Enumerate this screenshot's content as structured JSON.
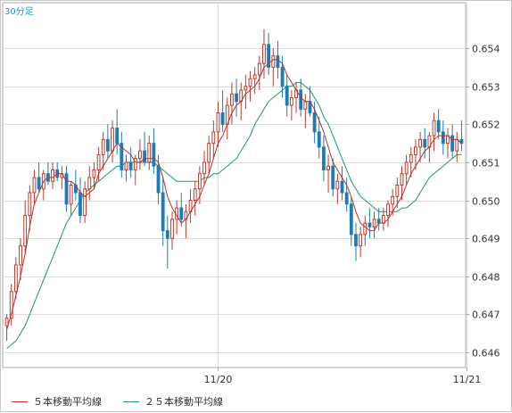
{
  "period_label": "30分足",
  "legend": {
    "ma5": "５本移動平均線",
    "ma25": "２５本移動平均線"
  },
  "colors": {
    "up": "#c0392b",
    "down": "#1f7bb8",
    "ma5": "#b6332b",
    "ma25": "#1a9a6a",
    "grid": "#dddddd",
    "axis": "#aaaaaa"
  },
  "chart_data": {
    "type": "candlestick",
    "title": "",
    "y_ticks": [
      "0.646",
      "0.647",
      "0.648",
      "0.649",
      "0.650",
      "0.651",
      "0.652",
      "0.653",
      "0.654"
    ],
    "x_labels": [
      {
        "label": "11/20",
        "index": 46
      },
      {
        "label": "11/21",
        "index": 100
      }
    ],
    "ylim": [
      0.6456,
      0.6552
    ],
    "grid": true,
    "legend_position": "bottom",
    "candles": [
      [
        0.6467,
        0.647,
        0.6463,
        0.6469
      ],
      [
        0.6469,
        0.6478,
        0.6467,
        0.6476
      ],
      [
        0.6476,
        0.6485,
        0.6474,
        0.6483
      ],
      [
        0.6483,
        0.649,
        0.6479,
        0.6488
      ],
      [
        0.6488,
        0.65,
        0.6486,
        0.6496
      ],
      [
        0.6496,
        0.6504,
        0.6492,
        0.6502
      ],
      [
        0.6502,
        0.6508,
        0.6499,
        0.6506
      ],
      [
        0.6506,
        0.651,
        0.6502,
        0.6503
      ],
      [
        0.6503,
        0.6508,
        0.65,
        0.6507
      ],
      [
        0.6507,
        0.651,
        0.6504,
        0.6505
      ],
      [
        0.6505,
        0.651,
        0.6503,
        0.6508
      ],
      [
        0.6508,
        0.651,
        0.6505,
        0.6506
      ],
      [
        0.6506,
        0.6509,
        0.6503,
        0.6507
      ],
      [
        0.6507,
        0.6509,
        0.6497,
        0.6499
      ],
      [
        0.6499,
        0.6505,
        0.6496,
        0.6504
      ],
      [
        0.6504,
        0.6508,
        0.65,
        0.6502
      ],
      [
        0.6502,
        0.6506,
        0.6494,
        0.6496
      ],
      [
        0.6496,
        0.6505,
        0.6494,
        0.6503
      ],
      [
        0.6503,
        0.6509,
        0.65,
        0.6506
      ],
      [
        0.6506,
        0.651,
        0.6503,
        0.6508
      ],
      [
        0.6508,
        0.6514,
        0.6505,
        0.6512
      ],
      [
        0.6512,
        0.6518,
        0.6508,
        0.6516
      ],
      [
        0.6516,
        0.652,
        0.6511,
        0.6513
      ],
      [
        0.6513,
        0.6521,
        0.651,
        0.6519
      ],
      [
        0.6519,
        0.6524,
        0.6512,
        0.6515
      ],
      [
        0.6515,
        0.6518,
        0.6506,
        0.6508
      ],
      [
        0.6508,
        0.6512,
        0.6505,
        0.651
      ],
      [
        0.651,
        0.6514,
        0.6506,
        0.6508
      ],
      [
        0.6508,
        0.6512,
        0.6504,
        0.6511
      ],
      [
        0.6511,
        0.6516,
        0.6508,
        0.6513
      ],
      [
        0.6513,
        0.6518,
        0.6509,
        0.651
      ],
      [
        0.651,
        0.6517,
        0.6508,
        0.6515
      ],
      [
        0.6515,
        0.6519,
        0.6507,
        0.6509
      ],
      [
        0.6509,
        0.6512,
        0.6499,
        0.6502
      ],
      [
        0.6502,
        0.6506,
        0.6488,
        0.6492
      ],
      [
        0.6492,
        0.6496,
        0.6482,
        0.649
      ],
      [
        0.649,
        0.6497,
        0.6487,
        0.6495
      ],
      [
        0.6495,
        0.65,
        0.6491,
        0.6498
      ],
      [
        0.6498,
        0.6502,
        0.6493,
        0.6495
      ],
      [
        0.6495,
        0.6499,
        0.649,
        0.6497
      ],
      [
        0.6497,
        0.6503,
        0.6494,
        0.65
      ],
      [
        0.65,
        0.6505,
        0.6496,
        0.6503
      ],
      [
        0.6503,
        0.6509,
        0.6499,
        0.6507
      ],
      [
        0.6507,
        0.6513,
        0.6504,
        0.651
      ],
      [
        0.651,
        0.6517,
        0.6507,
        0.6515
      ],
      [
        0.6515,
        0.6521,
        0.6511,
        0.6518
      ],
      [
        0.6518,
        0.6526,
        0.6514,
        0.6523
      ],
      [
        0.6523,
        0.6529,
        0.6518,
        0.652
      ],
      [
        0.652,
        0.6527,
        0.6516,
        0.6525
      ],
      [
        0.6525,
        0.6531,
        0.652,
        0.6528
      ],
      [
        0.6528,
        0.6532,
        0.6522,
        0.6526
      ],
      [
        0.6526,
        0.6531,
        0.6521,
        0.6529
      ],
      [
        0.6529,
        0.6533,
        0.6524,
        0.653
      ],
      [
        0.653,
        0.6534,
        0.6526,
        0.6532
      ],
      [
        0.6532,
        0.6535,
        0.6528,
        0.6533
      ],
      [
        0.6533,
        0.6538,
        0.6529,
        0.6536
      ],
      [
        0.6536,
        0.6545,
        0.6532,
        0.6541
      ],
      [
        0.6541,
        0.6544,
        0.6533,
        0.6535
      ],
      [
        0.6535,
        0.654,
        0.653,
        0.6538
      ],
      [
        0.6538,
        0.6542,
        0.6532,
        0.6535
      ],
      [
        0.6535,
        0.6538,
        0.6527,
        0.653
      ],
      [
        0.653,
        0.6533,
        0.6522,
        0.6525
      ],
      [
        0.6525,
        0.6529,
        0.6521,
        0.6527
      ],
      [
        0.6527,
        0.6531,
        0.6523,
        0.6529
      ],
      [
        0.6529,
        0.6532,
        0.6522,
        0.6524
      ],
      [
        0.6524,
        0.6528,
        0.6519,
        0.6526
      ],
      [
        0.6526,
        0.653,
        0.6522,
        0.6523
      ],
      [
        0.6523,
        0.6526,
        0.6515,
        0.6518
      ],
      [
        0.6518,
        0.6522,
        0.6511,
        0.6514
      ],
      [
        0.6514,
        0.6517,
        0.6505,
        0.6508
      ],
      [
        0.6508,
        0.6512,
        0.6502,
        0.6509
      ],
      [
        0.6509,
        0.6511,
        0.6501,
        0.6503
      ],
      [
        0.6503,
        0.6507,
        0.6499,
        0.6505
      ],
      [
        0.6505,
        0.6509,
        0.65,
        0.6502
      ],
      [
        0.6502,
        0.6506,
        0.6497,
        0.6499
      ],
      [
        0.6499,
        0.6501,
        0.6488,
        0.6491
      ],
      [
        0.6491,
        0.6494,
        0.6484,
        0.6488
      ],
      [
        0.6488,
        0.6493,
        0.6485,
        0.6491
      ],
      [
        0.6491,
        0.6496,
        0.6488,
        0.6494
      ],
      [
        0.6494,
        0.6498,
        0.649,
        0.6493
      ],
      [
        0.6493,
        0.6497,
        0.649,
        0.6495
      ],
      [
        0.6495,
        0.6498,
        0.6492,
        0.6494
      ],
      [
        0.6494,
        0.6498,
        0.6492,
        0.6496
      ],
      [
        0.6496,
        0.65,
        0.6493,
        0.6499
      ],
      [
        0.6499,
        0.6503,
        0.6496,
        0.6501
      ],
      [
        0.6501,
        0.6506,
        0.6498,
        0.6504
      ],
      [
        0.6504,
        0.6509,
        0.65,
        0.6507
      ],
      [
        0.6507,
        0.6512,
        0.6504,
        0.651
      ],
      [
        0.651,
        0.6514,
        0.6506,
        0.6512
      ],
      [
        0.6512,
        0.6516,
        0.6508,
        0.6514
      ],
      [
        0.6514,
        0.6518,
        0.651,
        0.6516
      ],
      [
        0.6516,
        0.6519,
        0.6511,
        0.6514
      ],
      [
        0.6514,
        0.6518,
        0.651,
        0.6517
      ],
      [
        0.6517,
        0.6523,
        0.6513,
        0.6521
      ],
      [
        0.6521,
        0.6524,
        0.6516,
        0.6518
      ],
      [
        0.6518,
        0.6521,
        0.6512,
        0.6515
      ],
      [
        0.6515,
        0.6519,
        0.6511,
        0.6517
      ],
      [
        0.6517,
        0.652,
        0.6511,
        0.6513
      ],
      [
        0.6513,
        0.6518,
        0.651,
        0.6516
      ],
      [
        0.6516,
        0.6521,
        0.6513,
        0.6515
      ]
    ],
    "series": [
      {
        "name": "５本移動平均線",
        "values": [
          0.6466,
          0.647,
          0.6475,
          0.648,
          0.6486,
          0.6493,
          0.6499,
          0.6502,
          0.6505,
          0.6506,
          0.6506,
          0.6507,
          0.6507,
          0.6505,
          0.6505,
          0.6504,
          0.6502,
          0.6501,
          0.6502,
          0.6503,
          0.6507,
          0.6509,
          0.6511,
          0.6513,
          0.6515,
          0.6514,
          0.6513,
          0.6512,
          0.651,
          0.651,
          0.6511,
          0.6511,
          0.6511,
          0.651,
          0.6506,
          0.6501,
          0.6498,
          0.6496,
          0.6494,
          0.6495,
          0.6497,
          0.6499,
          0.6501,
          0.6504,
          0.6507,
          0.6511,
          0.6515,
          0.6517,
          0.652,
          0.6523,
          0.6525,
          0.6526,
          0.6528,
          0.6529,
          0.653,
          0.6532,
          0.6535,
          0.6536,
          0.6537,
          0.6537,
          0.6536,
          0.6533,
          0.6531,
          0.6529,
          0.6527,
          0.6526,
          0.6526,
          0.6524,
          0.6521,
          0.6518,
          0.6514,
          0.651,
          0.6508,
          0.6506,
          0.6504,
          0.6501,
          0.6497,
          0.6494,
          0.6493,
          0.6492,
          0.6492,
          0.6494,
          0.6494,
          0.6495,
          0.6497,
          0.6499,
          0.6501,
          0.6504,
          0.6507,
          0.6509,
          0.6511,
          0.6513,
          0.6514,
          0.6516,
          0.6517,
          0.6517,
          0.6517,
          0.6516,
          0.6516,
          0.6515
        ]
      },
      {
        "name": "２５本移動平均線",
        "values": [
          0.6461,
          0.6462,
          0.6463,
          0.6465,
          0.6467,
          0.647,
          0.6473,
          0.6476,
          0.6479,
          0.6482,
          0.6485,
          0.6488,
          0.6491,
          0.6494,
          0.6496,
          0.6498,
          0.65,
          0.6502,
          0.6503,
          0.6504,
          0.6505,
          0.6506,
          0.6507,
          0.6508,
          0.6509,
          0.6509,
          0.651,
          0.651,
          0.651,
          0.651,
          0.651,
          0.651,
          0.651,
          0.6509,
          0.6508,
          0.6507,
          0.6506,
          0.6505,
          0.6505,
          0.6505,
          0.6505,
          0.6505,
          0.6505,
          0.6506,
          0.6506,
          0.6507,
          0.6507,
          0.6508,
          0.6509,
          0.651,
          0.6511,
          0.6513,
          0.6515,
          0.6517,
          0.652,
          0.6522,
          0.6524,
          0.6526,
          0.6527,
          0.6528,
          0.6529,
          0.653,
          0.653,
          0.6531,
          0.6531,
          0.653,
          0.6529,
          0.6527,
          0.6525,
          0.6522,
          0.652,
          0.6517,
          0.6514,
          0.6511,
          0.6508,
          0.6505,
          0.6503,
          0.6501,
          0.65,
          0.6499,
          0.6498,
          0.6497,
          0.6497,
          0.6497,
          0.6497,
          0.6497,
          0.6498,
          0.6498,
          0.6499,
          0.65,
          0.6502,
          0.6504,
          0.6506,
          0.6507,
          0.6508,
          0.6509,
          0.651,
          0.6511,
          0.6512,
          0.6512
        ]
      }
    ]
  }
}
